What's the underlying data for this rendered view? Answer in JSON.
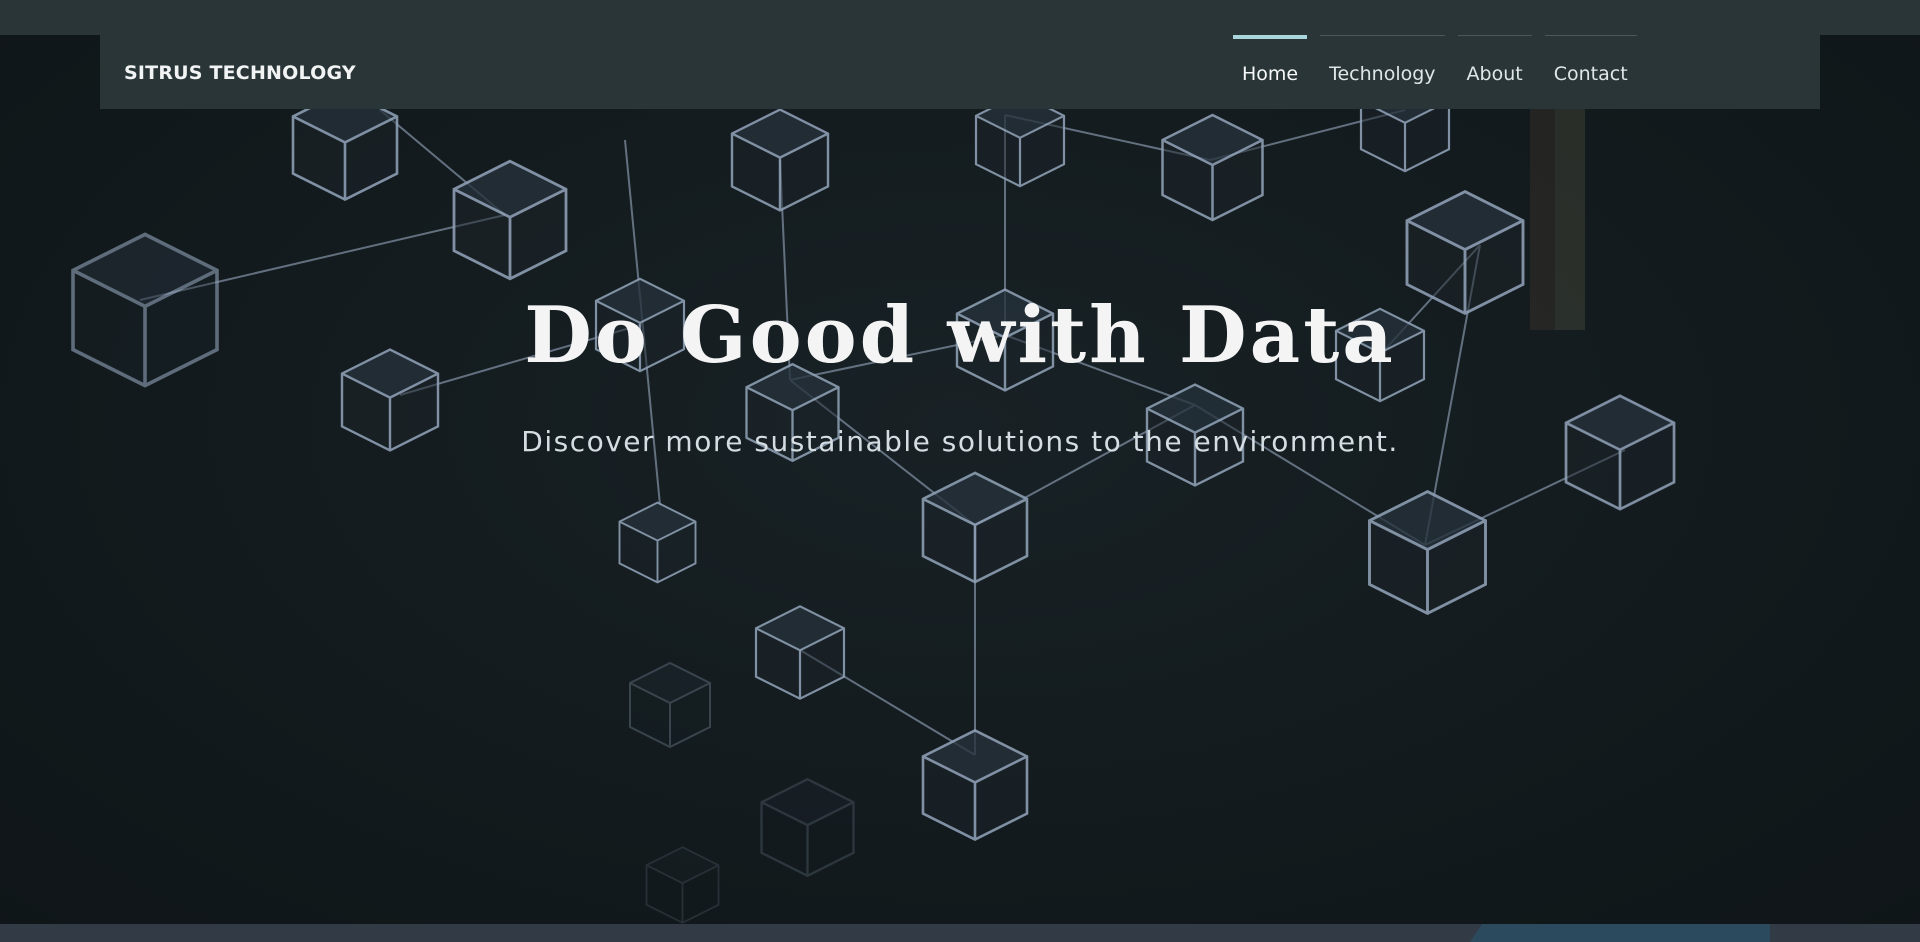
{
  "header": {
    "logo": "SITRUS TECHNOLOGY",
    "nav": [
      {
        "label": "Home",
        "active": true
      },
      {
        "label": "Technology",
        "active": false
      },
      {
        "label": "About",
        "active": false
      },
      {
        "label": "Contact",
        "active": false
      }
    ]
  },
  "hero": {
    "title": "Do Good with Data",
    "subtitle": "Discover more sustainable solutions to the environment.",
    "background": "cube-network-icon"
  },
  "colors": {
    "header_bg": "#2a3538",
    "page_bg": "#131a1d",
    "nav_active_accent": "#a9d6da",
    "title_text": "#f4f4f4"
  }
}
